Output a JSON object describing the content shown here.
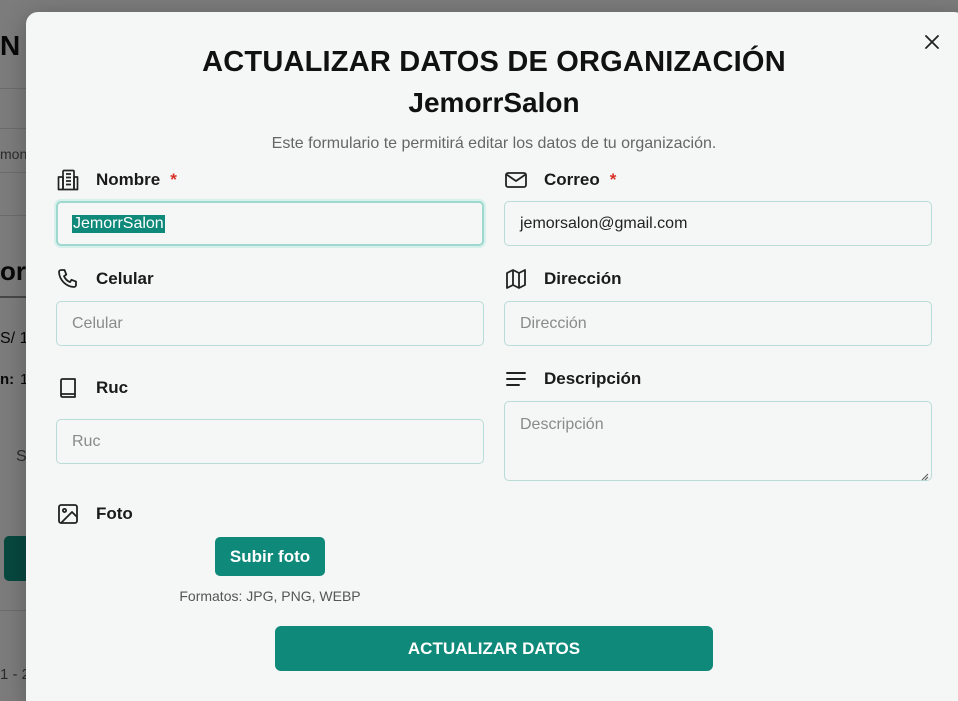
{
  "background": {
    "fragments": [
      "N",
      "mon",
      "or",
      "S/ 1",
      "n:",
      "1",
      "S",
      "1 - 2"
    ]
  },
  "modal": {
    "title": "ACTUALIZAR DATOS DE ORGANIZACIÓN",
    "org_name": "JemorrSalon",
    "description": "Este formulario te permitirá editar los datos de tu organización.",
    "close_icon": "close-icon",
    "fields": {
      "nombre": {
        "label": "Nombre",
        "required": "*",
        "value": "JemorrSalon",
        "icon": "building-icon"
      },
      "correo": {
        "label": "Correo",
        "required": "*",
        "value": "jemorsalon@gmail.com",
        "icon": "mail-icon"
      },
      "celular": {
        "label": "Celular",
        "placeholder": "Celular",
        "icon": "phone-icon"
      },
      "direccion": {
        "label": "Dirección",
        "placeholder": "Dirección",
        "icon": "map-icon"
      },
      "ruc": {
        "label": "Ruc",
        "placeholder": "Ruc",
        "icon": "book-icon"
      },
      "descripcion": {
        "label": "Descripción",
        "placeholder": "Descripción",
        "icon": "text-lines-icon"
      },
      "foto": {
        "label": "Foto",
        "icon": "image-icon"
      }
    },
    "upload_label": "Subir foto",
    "formats": "Formatos: JPG, PNG, WEBP",
    "submit_label": "ACTUALIZAR DATOS"
  },
  "colors": {
    "accent": "#0f8a7a",
    "required": "#d93025",
    "input_border": "#b9dcd6"
  }
}
